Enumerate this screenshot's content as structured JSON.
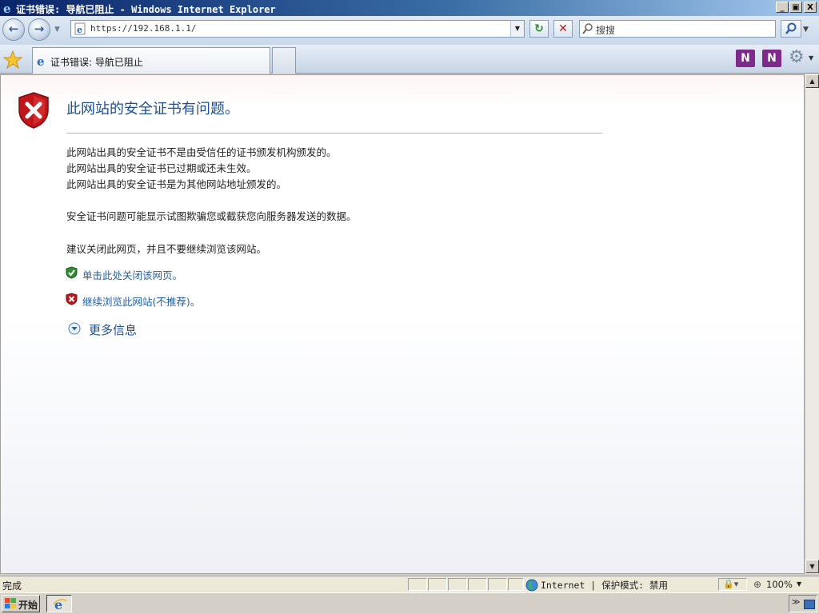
{
  "window": {
    "title": "证书错误: 导航已阻止 - Windows Internet Explorer",
    "minimize_glyph": "_",
    "restore_glyph": "▣",
    "close_glyph": "X"
  },
  "nav": {
    "url": "https://192.168.1.1/",
    "search_placeholder": "搜搜"
  },
  "tabs": [
    {
      "label": "证书错误: 导航已阻止"
    }
  ],
  "page": {
    "heading": "此网站的安全证书有问题。",
    "paragraphs": [
      "此网站出具的安全证书不是由受信任的证书颁发机构颁发的。",
      "此网站出具的安全证书已过期或还未生效。",
      "此网站出具的安全证书是为其他网站地址颁发的。",
      "安全证书问题可能显示试图欺骗您或截获您向服务器发送的数据。",
      "建议关闭此网页，并且不要继续浏览该网站。"
    ],
    "links": {
      "close_page": "单击此处关闭该网页。",
      "continue": "继续浏览此网站(不推荐)。",
      "more_info": "更多信息"
    }
  },
  "status": {
    "text": "完成",
    "zone": "Internet | 保护模式: 禁用",
    "zoom": "100%"
  },
  "taskbar": {
    "start": "开始"
  },
  "colors": {
    "heading": "#1f4f8f",
    "link": "#1f5ea6",
    "shield_red": "#c0161b",
    "shield_green": "#2f8f2f"
  }
}
